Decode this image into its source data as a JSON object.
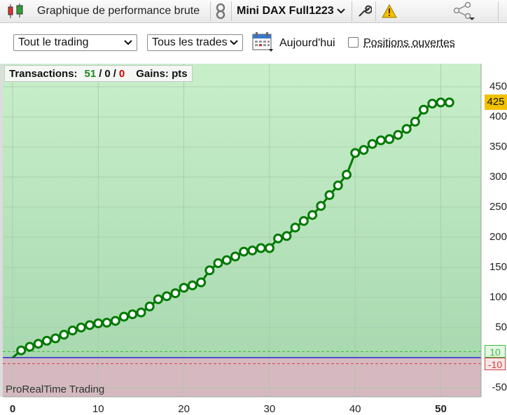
{
  "topbar": {
    "chart_title": "Graphique de performance brute",
    "instrument": "Mini DAX Full1223",
    "icons": [
      "candlestick-icon",
      "link-icon",
      "chevron-down-icon",
      "wrench-icon",
      "warning-icon",
      "share-icon"
    ]
  },
  "filters": {
    "scope_select": "Tout le trading",
    "trades_select": "Tous les trades",
    "date_label": "Aujourd'hui",
    "open_positions_label": "Positions ouvertes",
    "open_positions_checked": false
  },
  "legend": {
    "transactions_label": "Transactions:",
    "total": "51",
    "slash1": "/",
    "neutral": "0",
    "slash2": "/",
    "losing": "0",
    "gains_label": "Gains: pts"
  },
  "watermark": "ProRealTime Trading",
  "colors": {
    "curve": "#007a00",
    "positive_zone": "#bfe5c0",
    "negative_zone": "#d8b8be",
    "zero_line": "#2a2ad0",
    "current_badge": "#f2c200"
  },
  "chart_data": {
    "type": "line",
    "title": "",
    "xlabel": "",
    "ylabel": "",
    "xlim": [
      -1,
      54
    ],
    "ylim": [
      -60,
      460
    ],
    "x_ticks": [
      "0",
      "10",
      "20",
      "30",
      "40",
      "50"
    ],
    "y_ticks": [
      "450",
      "400",
      "350",
      "300",
      "250",
      "200",
      "150",
      "100",
      "50",
      "-50"
    ],
    "current_value": "425",
    "upper_threshold": "10",
    "lower_threshold": "-10",
    "series": [
      {
        "values": [
          0,
          12,
          18,
          23,
          28,
          32,
          38,
          45,
          50,
          54,
          57,
          58,
          61,
          68,
          72,
          75,
          85,
          97,
          102,
          107,
          116,
          120,
          125,
          145,
          157,
          162,
          168,
          176,
          178,
          182,
          182,
          198,
          202,
          216,
          227,
          237,
          252,
          270,
          286,
          304,
          340,
          345,
          355,
          361,
          363,
          370,
          380,
          392,
          412,
          422,
          424,
          424
        ]
      }
    ]
  }
}
